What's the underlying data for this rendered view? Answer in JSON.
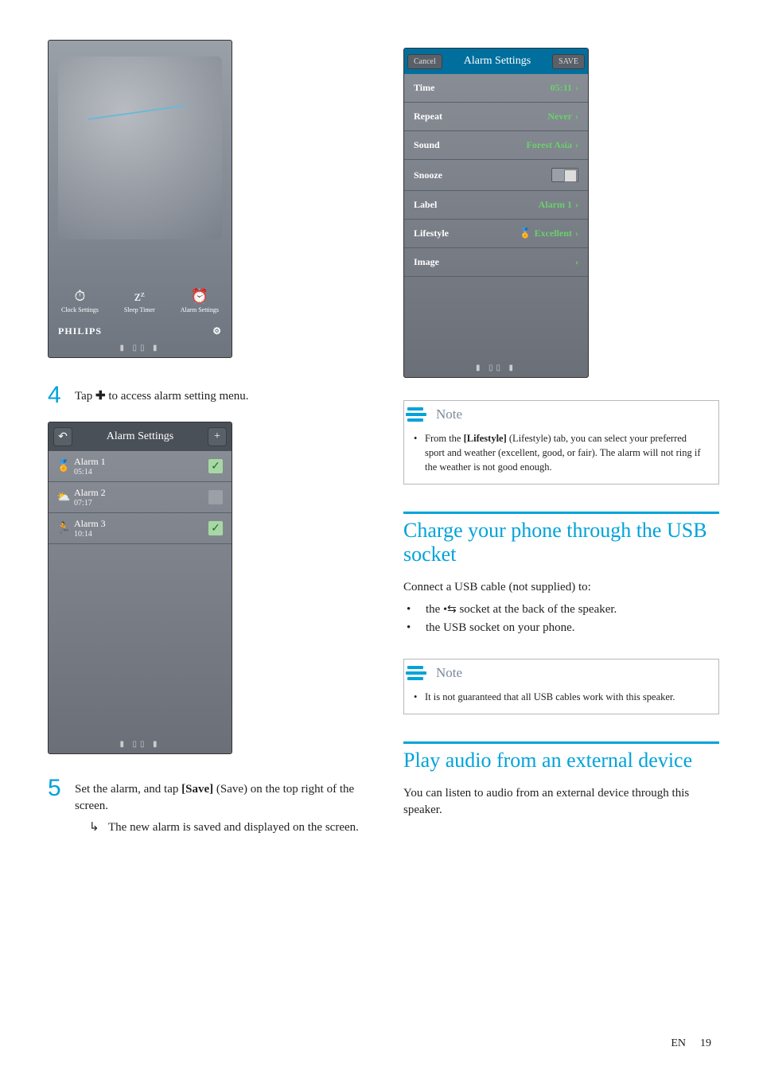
{
  "clock": {
    "tabs": [
      {
        "icon": "⏱",
        "label": "Clock Settings"
      },
      {
        "icon": "zᶻ",
        "label": "Sleep Timer"
      },
      {
        "icon": "⏰",
        "label": "Alarm Settings"
      }
    ],
    "brand": "PHILIPS",
    "gear": "⚙"
  },
  "step4": {
    "num": "4",
    "text_before": "Tap ",
    "plus": "✚",
    "text_after": " to access alarm setting menu."
  },
  "alarm_list": {
    "back": "↶",
    "title": "Alarm Settings",
    "add": "+",
    "rows": [
      {
        "icon": "🏅",
        "name": "Alarm 1",
        "time": "05:14",
        "checked": true
      },
      {
        "icon": "⛅",
        "name": "Alarm 2",
        "time": "07:17",
        "checked": false
      },
      {
        "icon": "🏃",
        "name": "Alarm 3",
        "time": "10:14",
        "checked": true
      }
    ]
  },
  "step5": {
    "num": "5",
    "line1_a": "Set the alarm, and tap ",
    "line1_b": "[Save]",
    "line1_c": " (Save) on the top right of the screen.",
    "sub": "The new alarm is saved and displayed on the screen."
  },
  "alarm_detail": {
    "cancel": "Cancel",
    "title": "Alarm Settings",
    "save": "SAVE",
    "rows": {
      "time": {
        "label": "Time",
        "value": "05:11"
      },
      "repeat": {
        "label": "Repeat",
        "value": "Never"
      },
      "sound": {
        "label": "Sound",
        "value": "Forest Asia"
      },
      "snooze": {
        "label": "Snooze"
      },
      "alabel": {
        "label": "Label",
        "value": "Alarm 1"
      },
      "lifestyle": {
        "label": "Lifestyle",
        "value": "Excellent",
        "icon": "🏅"
      },
      "image": {
        "label": "Image"
      }
    }
  },
  "note1": {
    "title": "Note",
    "text_a": "From the ",
    "text_b": "[Lifestyle]",
    "text_c": " (Lifestyle) tab, you can select your preferred sport and weather (excellent, good, or fair). The alarm will not ring if the weather is not good enough."
  },
  "sec_charge": {
    "title": "Charge your phone through the USB socket",
    "intro": "Connect a USB cable (not supplied) to:",
    "b1_a": "the ",
    "b1_b": " socket at the back of the speaker.",
    "b2": "the USB socket on your phone."
  },
  "note2": {
    "title": "Note",
    "text": "It is not guaranteed that all USB cables work with this speaker."
  },
  "sec_play": {
    "title": "Play audio from an external device",
    "text": "You can listen to audio from an external device through this speaker."
  },
  "footer": {
    "lang": "EN",
    "page": "19"
  }
}
